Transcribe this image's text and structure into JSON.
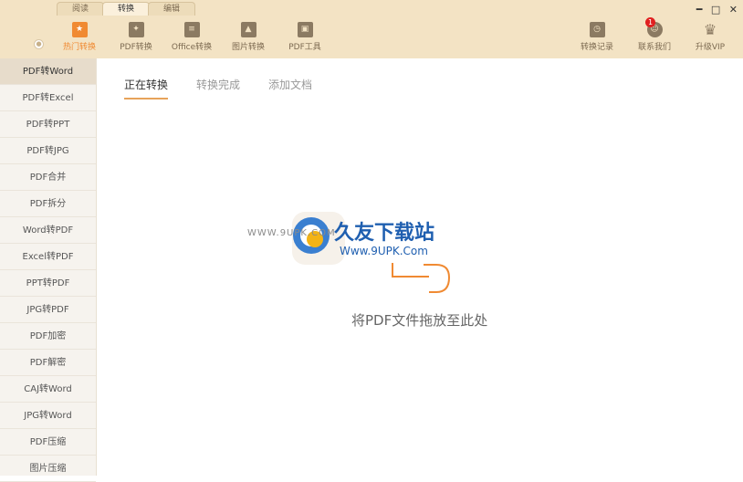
{
  "mode_tabs": [
    "阅读",
    "转换",
    "编辑"
  ],
  "toolbar": {
    "hot": "热门转换",
    "pdf": "PDF转换",
    "office": "Office转换",
    "image": "图片转换",
    "tools": "PDF工具",
    "history": "转换记录",
    "contact": "联系我们",
    "vip": "升级VIP",
    "badge": "1",
    "win_min": "━",
    "win_max": "□",
    "win_close": "✕"
  },
  "sidebar": {
    "items": [
      "PDF转Word",
      "PDF转Excel",
      "PDF转PPT",
      "PDF转JPG",
      "PDF合并",
      "PDF拆分",
      "Word转PDF",
      "Excel转PDF",
      "PPT转PDF",
      "JPG转PDF",
      "PDF加密",
      "PDF解密",
      "CAJ转Word",
      "JPG转Word",
      "PDF压缩",
      "图片压缩"
    ]
  },
  "main": {
    "tabs": [
      "正在转换",
      "转换完成",
      "添加文档"
    ],
    "drop_text": "将PDF文件拖放至此处"
  },
  "watermark": {
    "url_left": "WWW.9UPK.COM",
    "title": "久友下载站",
    "subtitle": "Www.9UPK.Com"
  },
  "colors": {
    "accent": "#f08a32",
    "topbar": "#f3e3c4"
  }
}
